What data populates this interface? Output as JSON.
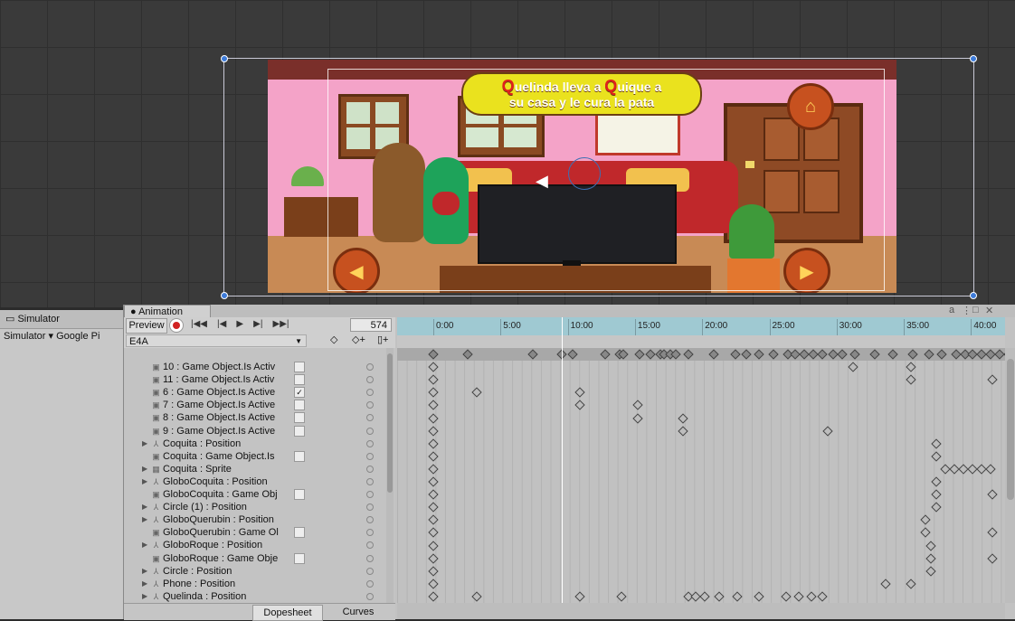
{
  "scene": {
    "speech_line1": "uelinda lleva a ",
    "speech_q1": "Q",
    "speech_q2": "Q",
    "speech_line1b": "uique a",
    "speech_line2": "su casa y le cura la pata"
  },
  "left_dock": {
    "tab_label": "Simulator",
    "simulator_dropdown": "Simulator ▾",
    "device_label": "Google Pi"
  },
  "animation": {
    "window_title": "Animation",
    "preview_label": "Preview",
    "current_frame": "574",
    "clip_name": "E4A",
    "timeline_ticks": [
      "0:00",
      "5:00",
      "10:00",
      "15:00",
      "20:00",
      "25:00",
      "30:00",
      "35:00",
      "40:00"
    ],
    "properties": [
      {
        "label": "10 : Game Object.Is Activ",
        "icon": "gameobject-icon",
        "check": "",
        "expandable": false
      },
      {
        "label": "11 : Game Object.Is Activ",
        "icon": "gameobject-icon",
        "check": "",
        "expandable": false
      },
      {
        "label": "6 : Game Object.Is Active",
        "icon": "gameobject-icon",
        "check": "✓",
        "expandable": false
      },
      {
        "label": "7 : Game Object.Is Active",
        "icon": "gameobject-icon",
        "check": "",
        "expandable": false
      },
      {
        "label": "8 : Game Object.Is Active",
        "icon": "gameobject-icon",
        "check": "",
        "expandable": false
      },
      {
        "label": "9 : Game Object.Is Active",
        "icon": "gameobject-icon",
        "check": "",
        "expandable": false
      },
      {
        "label": "Coquita : Position",
        "icon": "transform-icon",
        "check": null,
        "expandable": true
      },
      {
        "label": "Coquita : Game Object.Is",
        "icon": "gameobject-icon",
        "check": "",
        "expandable": false
      },
      {
        "label": "Coquita : Sprite",
        "icon": "sprite-icon",
        "check": null,
        "expandable": true
      },
      {
        "label": "GloboCoquita : Position",
        "icon": "transform-icon",
        "check": null,
        "expandable": true
      },
      {
        "label": "GloboCoquita : Game Obj",
        "icon": "gameobject-icon",
        "check": "",
        "expandable": false
      },
      {
        "label": "Circle (1) : Position",
        "icon": "transform-icon",
        "check": null,
        "expandable": true
      },
      {
        "label": "GloboQuerubin : Position",
        "icon": "transform-icon",
        "check": null,
        "expandable": true
      },
      {
        "label": "GloboQuerubin : Game Ol",
        "icon": "gameobject-icon",
        "check": "",
        "expandable": false
      },
      {
        "label": "GloboRoque : Position",
        "icon": "transform-icon",
        "check": null,
        "expandable": true
      },
      {
        "label": "GloboRoque : Game Obje",
        "icon": "gameobject-icon",
        "check": "",
        "expandable": false
      },
      {
        "label": "Circle : Position",
        "icon": "transform-icon",
        "check": null,
        "expandable": true
      },
      {
        "label": "Phone : Position",
        "icon": "transform-icon",
        "check": null,
        "expandable": true
      },
      {
        "label": "Quelinda : Position",
        "icon": "transform-icon",
        "check": null,
        "expandable": true
      }
    ],
    "keyframe_rows": [
      [
        0,
        38,
        110,
        142,
        154,
        190,
        206,
        210,
        228,
        240,
        251,
        255,
        262,
        268,
        282,
        310,
        334,
        346,
        360,
        376,
        392,
        400,
        410,
        420,
        430,
        442,
        452,
        466,
        488,
        508,
        530,
        548,
        562,
        578,
        588,
        596,
        606,
        616,
        626,
        636
      ],
      [
        0,
        464,
        528
      ],
      [
        0,
        528,
        618
      ],
      [
        0,
        48,
        162
      ],
      [
        0,
        162,
        226
      ],
      [
        0,
        226,
        276
      ],
      [
        0,
        276,
        436
      ],
      [
        0,
        556
      ],
      [
        0,
        556
      ],
      [
        0,
        566,
        576,
        586,
        596,
        606,
        616
      ],
      [
        0,
        556
      ],
      [
        0,
        556,
        618
      ],
      [
        0,
        556
      ],
      [
        0,
        544
      ],
      [
        0,
        544,
        618
      ],
      [
        0,
        550
      ],
      [
        0,
        550,
        618
      ],
      [
        0,
        550
      ],
      [
        0,
        500,
        528
      ],
      [
        0,
        48,
        162,
        208,
        282,
        290,
        300,
        316,
        336,
        360,
        390,
        404,
        418,
        430
      ]
    ],
    "tab_dopesheet": "Dopesheet",
    "tab_curves": "Curves"
  }
}
